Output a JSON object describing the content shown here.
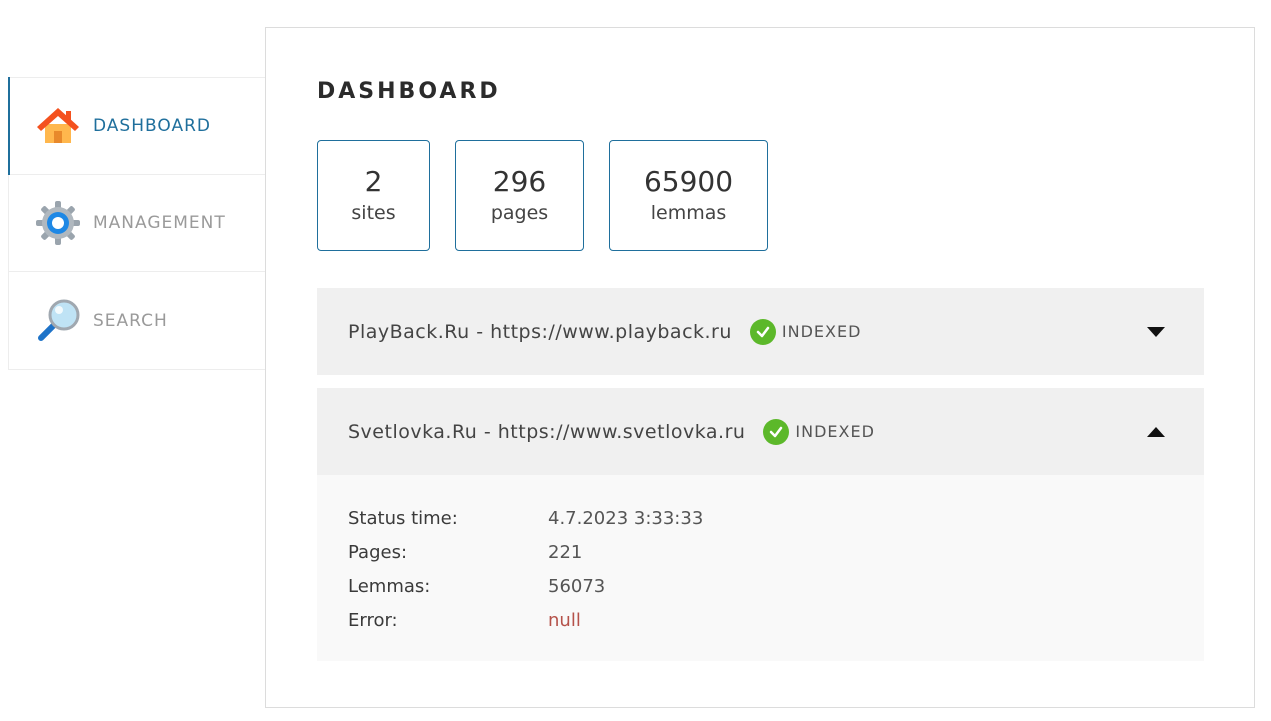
{
  "sidebar": {
    "items": [
      {
        "label": "DASHBOARD",
        "icon": "home-icon",
        "active": true
      },
      {
        "label": "MANAGEMENT",
        "icon": "gear-icon",
        "active": false
      },
      {
        "label": "SEARCH",
        "icon": "magnifier-icon",
        "active": false
      }
    ]
  },
  "main": {
    "title": "DASHBOARD",
    "stats": [
      {
        "value": "2",
        "label": "sites"
      },
      {
        "value": "296",
        "label": "pages"
      },
      {
        "value": "65900",
        "label": "lemmas"
      }
    ],
    "sites": [
      {
        "title": "PlayBack.Ru - https://www.playback.ru",
        "status": "INDEXED",
        "expanded": false
      },
      {
        "title": "Svetlovka.Ru - https://www.svetlovka.ru",
        "status": "INDEXED",
        "expanded": true,
        "details": {
          "status_time_label": "Status time:",
          "status_time": "4.7.2023 3:33:33",
          "pages_label": "Pages:",
          "pages": "221",
          "lemmas_label": "Lemmas:",
          "lemmas": "56073",
          "error_label": "Error:",
          "error": "null"
        }
      }
    ]
  },
  "colors": {
    "accent": "#1f6f9c",
    "status_ok": "#5cb82a",
    "error_text": "#b5524a"
  }
}
